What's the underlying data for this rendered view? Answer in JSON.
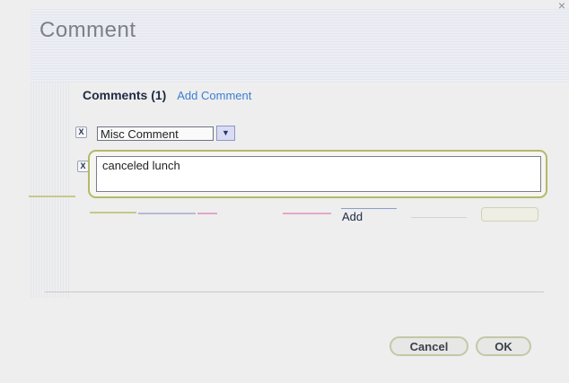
{
  "dialog": {
    "title": "Comment",
    "close_glyph": "×"
  },
  "comments": {
    "header": "Comments (1)",
    "add_link": "Add Comment",
    "remove_glyph": "X",
    "type_value": "Misc Comment",
    "dropdown_glyph": "▼",
    "text_value": "canceled lunch"
  },
  "footer": {
    "add_label": "Add",
    "cancel_label": "Cancel",
    "ok_label": "OK"
  },
  "colors": {
    "accent_link": "#3a7fd2",
    "focus_outline": "#b5b86a"
  }
}
